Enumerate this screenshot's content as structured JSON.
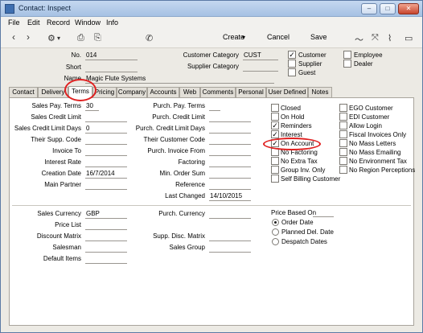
{
  "window": {
    "title": "Contact: Inspect"
  },
  "menu": [
    "File",
    "Edit",
    "Record",
    "Window",
    "Info"
  ],
  "toolbar": {
    "create": "Create",
    "cancel": "Cancel",
    "save": "Save",
    "create_arrow": "▾",
    "gear_arrow": "▾",
    "back": "‹",
    "forward": "›"
  },
  "header": {
    "no_label": "No.",
    "no_value": "014",
    "short_label": "Short",
    "short_value": "",
    "name_label": "Name",
    "name_value": "Magic Flute Systems",
    "cust_cat_label": "Customer Category",
    "cust_cat_value": "CUST",
    "supp_cat_label": "Supplier Category",
    "supp_cat_value": "",
    "customer_label": "Customer",
    "supplier_label": "Supplier",
    "guest_label": "Guest",
    "employee_label": "Employee",
    "dealer_label": "Dealer",
    "customer_checked": true,
    "supplier_checked": false,
    "guest_checked": false,
    "employee_checked": false,
    "dealer_checked": false
  },
  "tabs": [
    "Contact",
    "Delivery",
    "Terms",
    "Pricing",
    "Company",
    "Accounts",
    "Web",
    "Comments",
    "Personal",
    "User Defined",
    "Notes"
  ],
  "active_tab": "Terms",
  "terms": {
    "sales_pay_terms_label": "Sales Pay. Terms",
    "sales_pay_terms_value": "30",
    "sales_credit_limit_label": "Sales Credit Limit",
    "sales_credit_limit_value": "",
    "sales_credit_limit_days_label": "Sales Credit Limit Days",
    "sales_credit_limit_days_value": "0",
    "their_supp_code_label": "Their Supp. Code",
    "their_supp_code_value": "",
    "invoice_to_label": "Invoice To",
    "invoice_to_value": "",
    "interest_rate_label": "Interest Rate",
    "interest_rate_value": "",
    "creation_date_label": "Creation Date",
    "creation_date_value": "16/7/2014",
    "main_partner_label": "Main Partner",
    "main_partner_value": "",
    "purch_pay_terms_label": "Purch. Pay. Terms",
    "purch_pay_terms_value": "",
    "purch_credit_limit_label": "Purch. Credit Limit",
    "purch_credit_limit_value": "",
    "purch_credit_limit_days_label": "Purch. Credit Limit Days",
    "purch_credit_limit_days_value": "",
    "their_customer_code_label": "Their Customer Code",
    "their_customer_code_value": "",
    "purch_invoice_from_label": "Purch. Invoice From",
    "purch_invoice_from_value": "",
    "factoring_label": "Factoring",
    "factoring_value": "",
    "min_order_sum_label": "Min. Order Sum",
    "min_order_sum_value": "",
    "reference_label": "Reference",
    "reference_value": "",
    "last_changed_label": "Last Changed",
    "last_changed_value": "14/10/2015"
  },
  "flags_left": [
    {
      "label": "Closed",
      "checked": false
    },
    {
      "label": "On Hold",
      "checked": false
    },
    {
      "label": "Reminders",
      "checked": true
    },
    {
      "label": "Interest",
      "checked": true
    },
    {
      "label": "On Account",
      "checked": true
    },
    {
      "label": "No Factoring",
      "checked": false
    },
    {
      "label": "No Extra Tax",
      "checked": false
    },
    {
      "label": "Group Inv. Only",
      "checked": false
    },
    {
      "label": "Self Billing Customer",
      "checked": false
    }
  ],
  "flags_right": [
    {
      "label": "EGO Customer",
      "checked": false
    },
    {
      "label": "EDI Customer",
      "checked": false
    },
    {
      "label": "Allow Login",
      "checked": false
    },
    {
      "label": "Fiscal Invoices Only",
      "checked": false
    },
    {
      "label": "No Mass Letters",
      "checked": false
    },
    {
      "label": "No Mass Emailing",
      "checked": false
    },
    {
      "label": "No Environment Tax",
      "checked": false
    },
    {
      "label": "No Region Perceptions",
      "checked": false
    }
  ],
  "lower": {
    "sales_currency_label": "Sales Currency",
    "sales_currency_value": "GBP",
    "price_list_label": "Price List",
    "price_list_value": "",
    "discount_matrix_label": "Discount Matrix",
    "discount_matrix_value": "",
    "salesman_label": "Salesman",
    "salesman_value": "",
    "default_items_label": "Default Items",
    "default_items_value": "",
    "purch_currency_label": "Purch. Currency",
    "purch_currency_value": "",
    "supp_disc_matrix_label": "Supp. Disc. Matrix",
    "supp_disc_matrix_value": "",
    "sales_group_label": "Sales Group",
    "sales_group_value": "",
    "price_based_on_label": "Price Based On",
    "price_based_on_options": [
      "Order Date",
      "Planned Del. Date",
      "Despatch Dates"
    ],
    "price_based_on_selected": 0
  },
  "colors": {
    "annotation": "#e02020",
    "title_bar": "#a6c1e3"
  }
}
